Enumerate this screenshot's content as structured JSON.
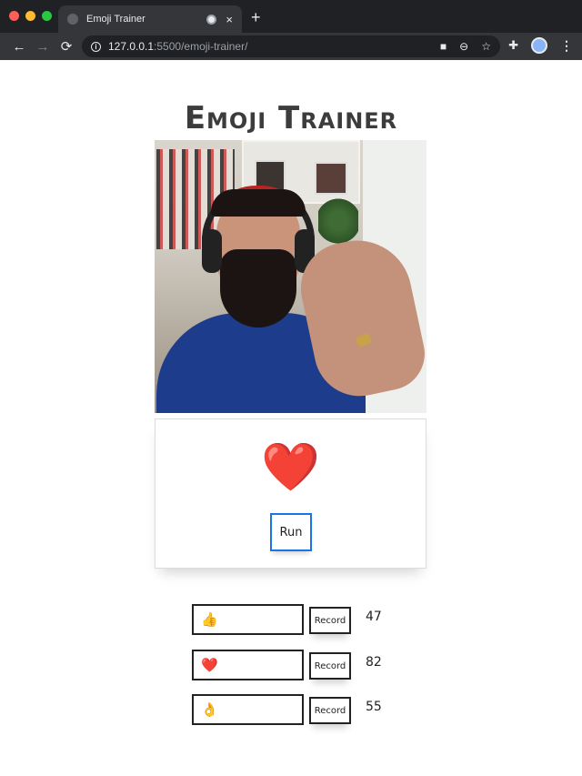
{
  "browser": {
    "tab_title": "Emoji Trainer",
    "tab_close": "×",
    "new_tab": "+",
    "url_host": "127.0.0.1",
    "url_rest": ":5500/emoji-trainer/",
    "back": "←",
    "forward": "→",
    "reload": "⟳",
    "icons": [
      "camera-icon",
      "zoom-out-icon",
      "star-icon",
      "extensions-icon",
      "profile-avatar",
      "menu-icon"
    ]
  },
  "page": {
    "title": "Emoji Trainer",
    "prediction_emoji": "❤️",
    "run_label": "Run",
    "rows": [
      {
        "emoji": "👍",
        "record_label": "Record",
        "count": "47"
      },
      {
        "emoji": "❤️",
        "record_label": "Record",
        "count": "82"
      },
      {
        "emoji": "👌",
        "record_label": "Record",
        "count": "55"
      }
    ]
  }
}
